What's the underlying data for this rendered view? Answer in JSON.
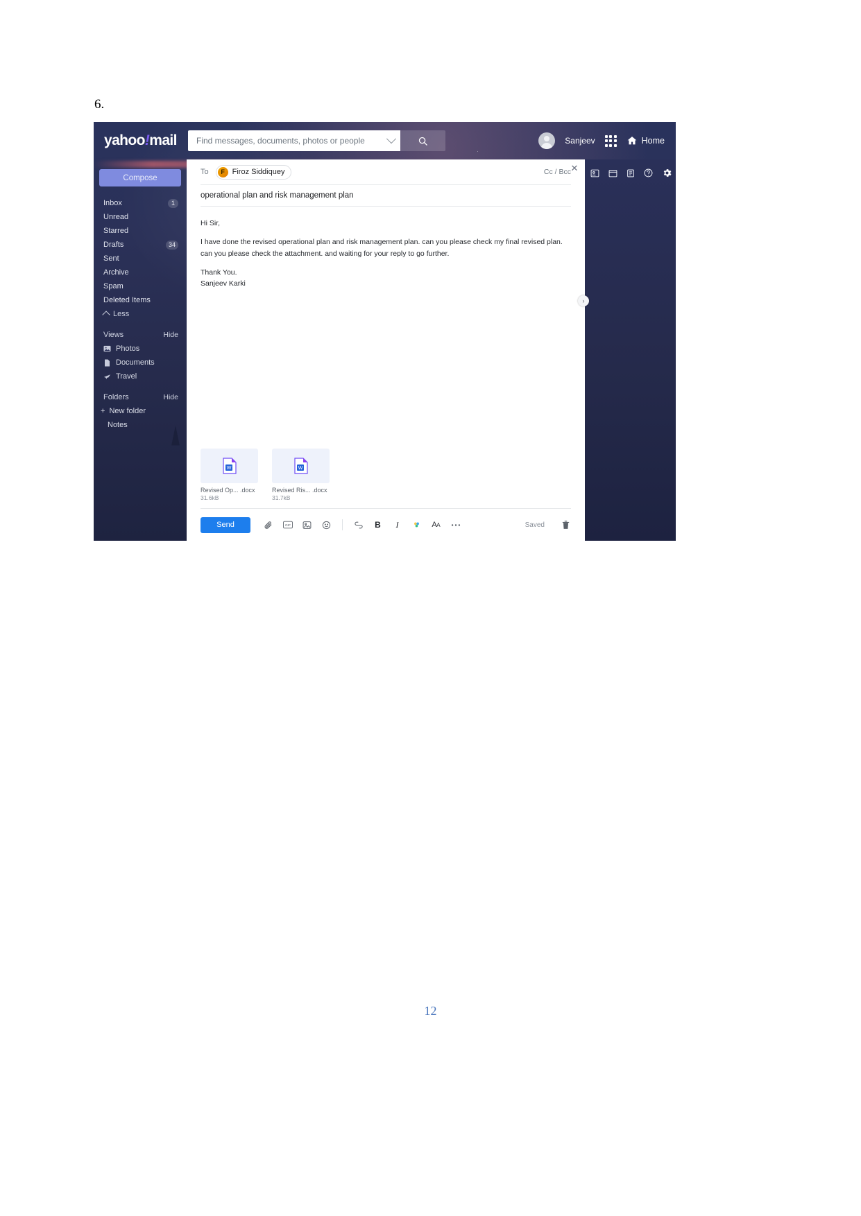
{
  "document": {
    "item_number": "6.",
    "page_number": "12"
  },
  "app": {
    "brand_primary": "yahoo",
    "brand_secondary": "mail",
    "accent_color": "#7b5cf0",
    "send_color": "#1d7eed"
  },
  "header": {
    "search": {
      "placeholder": "Find messages, documents, photos or people",
      "value": "",
      "dropdown_icon": "chevron-down-icon",
      "search_icon": "search-icon"
    },
    "user_name": "Sanjeev",
    "apps_icon": "apps-grid-icon",
    "home_icon": "home-icon",
    "home_label": "Home"
  },
  "sidebar": {
    "compose_label": "Compose",
    "folders": [
      {
        "label": "Inbox",
        "badge": "1"
      },
      {
        "label": "Unread",
        "badge": ""
      },
      {
        "label": "Starred",
        "badge": ""
      },
      {
        "label": "Drafts",
        "badge": "34"
      },
      {
        "label": "Sent",
        "badge": ""
      },
      {
        "label": "Archive",
        "badge": ""
      },
      {
        "label": "Spam",
        "badge": ""
      },
      {
        "label": "Deleted Items",
        "badge": ""
      }
    ],
    "less_label": "Less",
    "views": {
      "title": "Views",
      "action": "Hide",
      "items": [
        {
          "label": "Photos",
          "icon": "photo-icon"
        },
        {
          "label": "Documents",
          "icon": "document-icon"
        },
        {
          "label": "Travel",
          "icon": "plane-icon"
        }
      ]
    },
    "folders_section": {
      "title": "Folders",
      "action": "Hide",
      "new_folder_label": "New folder",
      "items": [
        {
          "label": "Notes"
        }
      ]
    }
  },
  "compose": {
    "close_icon": "close-icon",
    "to_label": "To",
    "recipient": {
      "name": "Firoz Siddiquey",
      "initial": "F"
    },
    "ccbcc_label": "Cc / Bcc",
    "subject": "operational plan and risk management plan",
    "body": {
      "greeting": "Hi  Sir,",
      "paragraph_line1": "I have done the revised operational plan and risk management plan. can you please check my final revised plan.",
      "paragraph_line2": "can you please check the attachment. and waiting for your reply to go further.",
      "closing": "Thank You.",
      "signature": "Sanjeev Karki"
    },
    "attachments": [
      {
        "name": "Revised Op... .docx",
        "size": "31.6kB",
        "icon": "word-doc-icon"
      },
      {
        "name": "Revised Ris... .docx",
        "size": "31.7kB",
        "icon": "word-doc-icon"
      }
    ],
    "toolbar": {
      "send_label": "Send",
      "icons": [
        "attach-icon",
        "gif-icon",
        "image-icon",
        "emoji-icon",
        "link-icon",
        "bold-icon",
        "italic-icon",
        "text-color-icon",
        "font-size-icon",
        "more-options-icon"
      ],
      "status_label": "Saved",
      "delete_icon": "trash-icon"
    },
    "collapse_icon": "chevron-right-icon"
  },
  "right_rail": {
    "icons": [
      "contacts-icon",
      "calendar-icon",
      "notepad-icon",
      "help-icon",
      "settings-gear-icon"
    ]
  }
}
